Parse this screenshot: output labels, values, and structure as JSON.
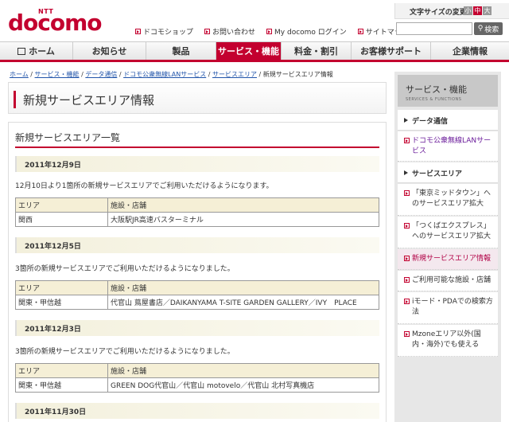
{
  "header": {
    "ntt_mark": "NTT",
    "logo": "docomo",
    "text_size_label": "文字サイズの変更",
    "text_size_small": "小",
    "text_size_mid": "中",
    "text_size_large": "大",
    "util_links": [
      "ドコモショップ",
      "お問い合わせ",
      "My docomo ログイン",
      "サイトマップ"
    ],
    "search_placeholder": "",
    "search_button": "検索"
  },
  "gnav": {
    "home": "ホーム",
    "news": "お知らせ",
    "products": "製品",
    "service": "サービス・機能",
    "fee": "料金・割引",
    "support": "お客様サポート",
    "corp": "企業情報"
  },
  "breadcrumb": {
    "items": [
      "ホーム",
      "サービス・機能",
      "データ通信",
      "ドコモ公衆無線LANサービス",
      "サービスエリア"
    ],
    "sep": " / ",
    "current": "新規サービスエリア情報"
  },
  "page": {
    "title": "新規サービスエリア情報",
    "section_title": "新規サービスエリア一覧",
    "table_header_area": "エリア",
    "table_header_facility": "施設・店舗",
    "entries": [
      {
        "date": "2011年12月9日",
        "desc": "12月10日より1箇所の新規サービスエリアでご利用いただけるようになります。",
        "area": "関西",
        "facility": "大阪駅JR高速バスターミナル"
      },
      {
        "date": "2011年12月5日",
        "desc": "3箇所の新規サービスエリアでご利用いただけるようになりました。",
        "area": "関東・甲信越",
        "facility": "代官山 蔦屋書店／DAIKANYAMA T-SITE GARDEN GALLERY／IVY　PLACE"
      },
      {
        "date": "2011年12月3日",
        "desc": "3箇所の新規サービスエリアでご利用いただけるようになりました。",
        "area": "関東・甲信越",
        "facility": "GREEN DOG代官山／代官山 motovelo／代官山 北村写真機店"
      },
      {
        "date": "2011年11月30日"
      }
    ]
  },
  "sidebar": {
    "header_jp": "サービス・機能",
    "header_en": "SERVICES & FUNCTIONS",
    "data_section": "データ通信",
    "wlan_link": "ドコモ公衆無線LANサービス",
    "area_section": "サービスエリア",
    "links": [
      "「東京ミッドタウン」へのサービスエリア拡大",
      "「つくばエクスプレス」へのサービスエリア拡大",
      "新規サービスエリア情報",
      "ご利用可能な施設・店舗",
      "iモード・PDAでの検索方法",
      "Mzoneエリア以外(国内・海外)でも使える"
    ]
  }
}
